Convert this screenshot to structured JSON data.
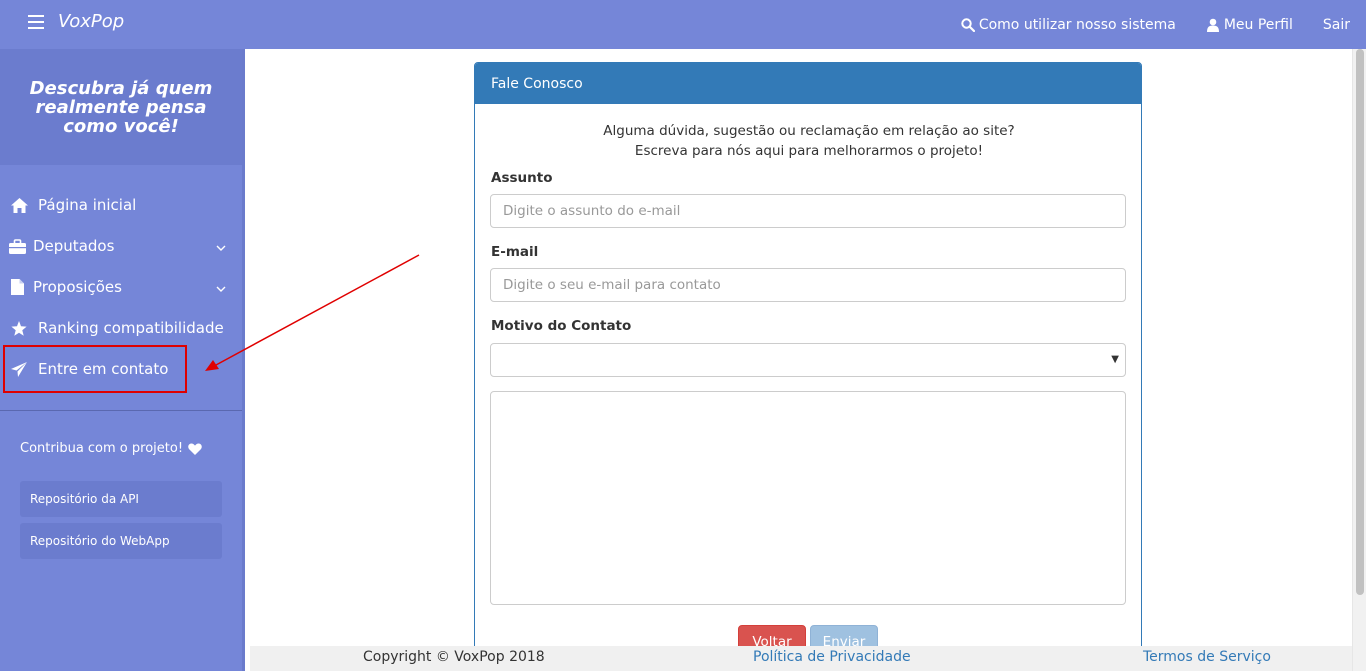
{
  "app": {
    "brand": "VoxPop",
    "nav": {
      "help_label": "Como utilizar nosso sistema",
      "profile_label": "Meu Perfil",
      "logout_label": "Sair"
    }
  },
  "sidebar": {
    "tagline": "Descubra já quem realmente pensa como você!",
    "items": [
      {
        "label": "Página inicial",
        "icon": "home-icon"
      },
      {
        "label": "Deputados",
        "icon": "briefcase-icon",
        "expandable": true
      },
      {
        "label": "Proposições",
        "icon": "file-icon",
        "expandable": true
      },
      {
        "label": "Ranking compatibilidade",
        "icon": "star-icon"
      },
      {
        "label": "Entre em contato",
        "icon": "send-icon",
        "highlighted": true
      }
    ],
    "contribute_label": "Contribua com o projeto!",
    "repos": [
      {
        "label": "Repositório da API"
      },
      {
        "label": "Repositório do WebApp"
      }
    ]
  },
  "contact_form": {
    "heading": "Fale Conosco",
    "intro_line1": "Alguma dúvida, sugestão ou reclamação em relação ao site?",
    "intro_line2": "Escreva para nós aqui para melhorarmos o projeto!",
    "subject_label": "Assunto",
    "subject_placeholder": "Digite o assunto do e-mail",
    "email_label": "E-mail",
    "email_placeholder": "Digite o seu e-mail para contato",
    "reason_label": "Motivo do Contato",
    "reason_value": "",
    "message_value": "",
    "back_label": "Voltar",
    "send_label": "Enviar"
  },
  "footer": {
    "copyright": "Copyright © VoxPop 2018",
    "privacy_label": "Política de Privacidade",
    "terms_label": "Termos de Serviço"
  },
  "colors": {
    "primary_nav": "#7586d8",
    "panel_header": "#337ab7",
    "danger": "#d9534f",
    "send_disabled": "#9fc1e0",
    "annotation": "#e00000"
  }
}
